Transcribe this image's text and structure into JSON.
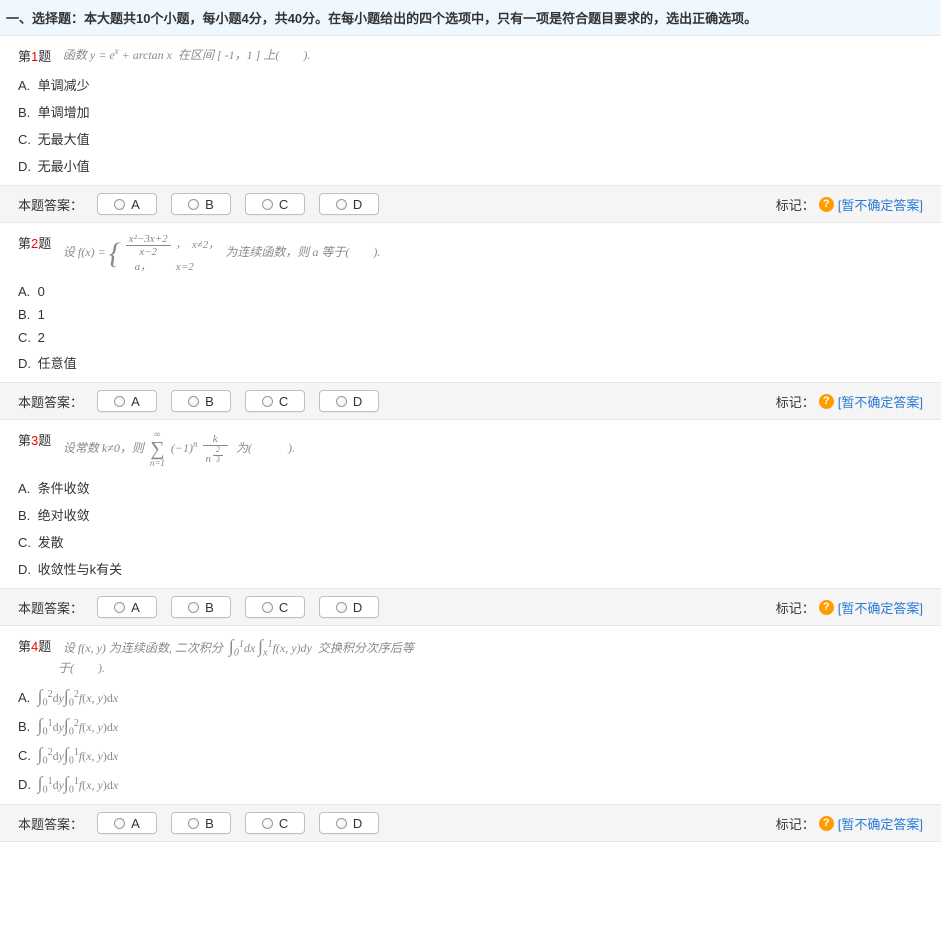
{
  "section_header": "一、选择题：本大题共10个小题，每小题4分，共40分。在每小题给出的四个选项中，只有一项是符合题目要求的，选出正确选项。",
  "labels": {
    "q_prefix": "第",
    "q_suffix": "题",
    "answer_label": "本题答案：",
    "mark_label": "标记：",
    "hint_text": "[暂不确定答案]",
    "help": "?",
    "btn_A": "A",
    "btn_B": "B",
    "btn_C": "C",
    "btn_D": "D"
  },
  "questions": [
    {
      "num": "1",
      "stem": "函数 y = eˣ + arctan x  在区间 [ -1，1 ] 上(　　).",
      "options": [
        "单调减少",
        "单调增加",
        "无最大值",
        "无最小值"
      ]
    },
    {
      "num": "2",
      "stem": "设 f(x) = { (x²−3x+2)/(x−2) , x≠2 ;  a , x=2 } 为连续函数, 则 a 等于(　　).",
      "options": [
        "0",
        "1",
        "2",
        "任意值"
      ]
    },
    {
      "num": "3",
      "stem": "设常数 k ≠ 0 , 则  Σ_{n=1}^{∞} (−1)ⁿ · k / n^(2/3)  为(　　).",
      "options": [
        "条件收敛",
        "绝对收敛",
        "发散",
        "收敛性与k有关"
      ]
    },
    {
      "num": "4",
      "stem": "设 f(x, y) 为连续函数, 二次积分 ∫₀¹ dx ∫ₓ¹ f(x, y) dy 交换积分次序后等于(　　).",
      "options": [
        "∫₀² dy ∫₀² f(x, y) dx",
        "∫₀¹ dy ∫₀² f(x, y) dx",
        "∫₀² dy ∫₀¹ f(x, y) dx",
        "∫₀¹ dy ∫₀¹ f(x, y) dx"
      ]
    }
  ]
}
